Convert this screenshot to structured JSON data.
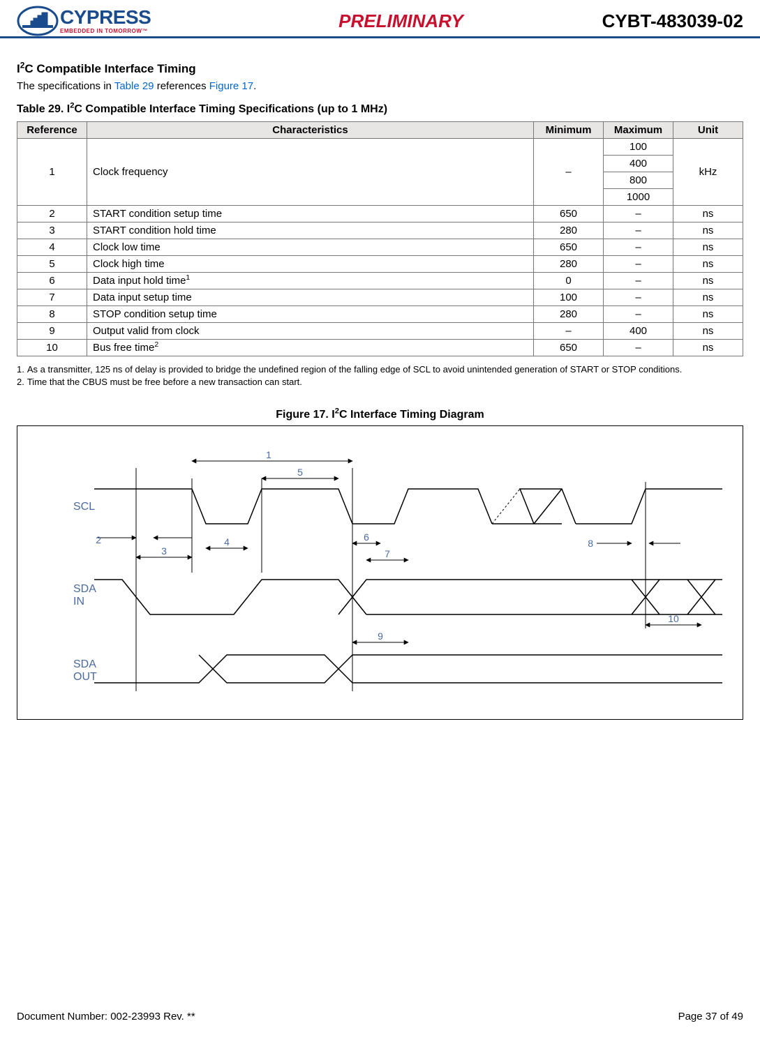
{
  "header": {
    "logo_main": "CYPRESS",
    "logo_tag": "EMBEDDED IN TOMORROW™",
    "preliminary": "PRELIMINARY",
    "part_number": "CYBT-483039-02"
  },
  "section": {
    "title_pre": "I",
    "title_sup": "2",
    "title_post": "C Compatible Interface Timing",
    "intro_pre": "The specifications in ",
    "intro_link1": "Table 29",
    "intro_mid": " references ",
    "intro_link2": "Figure 17",
    "intro_post": "."
  },
  "table": {
    "caption_pre": "Table 29.  I",
    "caption_sup": "2",
    "caption_post": "C Compatible Interface Timing Specifications (up to 1 MHz)",
    "headers": {
      "reference": "Reference",
      "characteristics": "Characteristics",
      "minimum": "Minimum",
      "maximum": "Maximum",
      "unit": "Unit"
    },
    "rows": [
      {
        "ref": "1",
        "char": "Clock frequency",
        "min": "–",
        "max": [
          "100",
          "400",
          "800",
          "1000"
        ],
        "unit": "kHz"
      },
      {
        "ref": "2",
        "char": "START condition setup time",
        "min": "650",
        "max": "–",
        "unit": "ns"
      },
      {
        "ref": "3",
        "char": "START condition hold time",
        "min": "280",
        "max": "–",
        "unit": "ns"
      },
      {
        "ref": "4",
        "char": "Clock low time",
        "min": "650",
        "max": "–",
        "unit": "ns"
      },
      {
        "ref": "5",
        "char": "Clock high time",
        "min": "280",
        "max": "–",
        "unit": "ns"
      },
      {
        "ref": "6",
        "char": "Data input hold time",
        "char_sup": "1",
        "min": "0",
        "max": "–",
        "unit": "ns"
      },
      {
        "ref": "7",
        "char": "Data input setup time",
        "min": "100",
        "max": "–",
        "unit": "ns"
      },
      {
        "ref": "8",
        "char": "STOP condition setup time",
        "min": "280",
        "max": "–",
        "unit": "ns"
      },
      {
        "ref": "9",
        "char": "Output valid from clock",
        "min": "–",
        "max": "400",
        "unit": "ns"
      },
      {
        "ref": "10",
        "char": "Bus free time",
        "char_sup": "2",
        "min": "650",
        "max": "–",
        "unit": "ns"
      }
    ]
  },
  "notes": [
    {
      "num": "1.",
      "text": "As a transmitter, 125 ns of delay is provided to bridge the undefined region of the falling edge of SCL to avoid unintended generation of START or STOP conditions."
    },
    {
      "num": "2.",
      "text": "Time that the CBUS must be free before a new transaction can start."
    }
  ],
  "figure": {
    "caption_pre": "Figure 17.  I",
    "caption_sup": "2",
    "caption_post": "C Interface Timing Diagram",
    "labels": {
      "scl": "SCL",
      "sda_in_1": "SDA",
      "sda_in_2": "IN",
      "sda_out_1": "SDA",
      "sda_out_2": "OUT",
      "m1": "1",
      "m2": "2",
      "m3": "3",
      "m4": "4",
      "m5": "5",
      "m6": "6",
      "m7": "7",
      "m8": "8",
      "m9": "9",
      "m10": "10"
    }
  },
  "footer": {
    "doc": "Document Number: 002-23993 Rev. **",
    "page": "Page 37 of 49"
  }
}
